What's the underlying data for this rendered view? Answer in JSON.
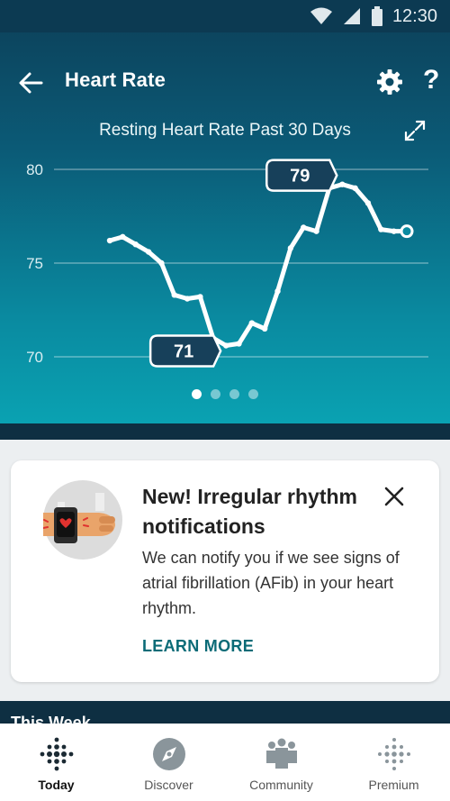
{
  "status_bar": {
    "time": "12:30"
  },
  "header": {
    "title": "Heart Rate"
  },
  "chart_data": {
    "type": "line",
    "title": "Resting Heart Rate Past 30 Days",
    "ylim": [
      70,
      80
    ],
    "y_ticks": [
      80,
      75,
      70
    ],
    "x": [
      1,
      2,
      3,
      4,
      5,
      6,
      7,
      8,
      9,
      10,
      11,
      12,
      13,
      14,
      15,
      16,
      17,
      18,
      19,
      20,
      21,
      22,
      23,
      24
    ],
    "values": [
      76.2,
      76.4,
      76.0,
      75.6,
      75.0,
      73.3,
      73.1,
      73.2,
      71.0,
      70.6,
      70.7,
      71.8,
      71.5,
      73.5,
      75.8,
      76.9,
      76.7,
      79.0,
      79.2,
      79.0,
      78.2,
      76.8,
      76.7,
      76.7
    ],
    "callouts": [
      {
        "label": "79",
        "index": 18
      },
      {
        "label": "71",
        "index": 9
      }
    ],
    "grid": true
  },
  "pager": {
    "count": 4,
    "active": 0
  },
  "card": {
    "headline": "New! Irregular rhythm notifications",
    "body": "We can notify you if we see signs of atrial fibrillation (AFib) in your heart rhythm.",
    "link": "LEARN MORE"
  },
  "section": {
    "this_week": "This Week"
  },
  "nav": {
    "items": [
      {
        "label": "Today",
        "active": true
      },
      {
        "label": "Discover",
        "active": false
      },
      {
        "label": "Community",
        "active": false
      },
      {
        "label": "Premium",
        "active": false
      }
    ]
  }
}
